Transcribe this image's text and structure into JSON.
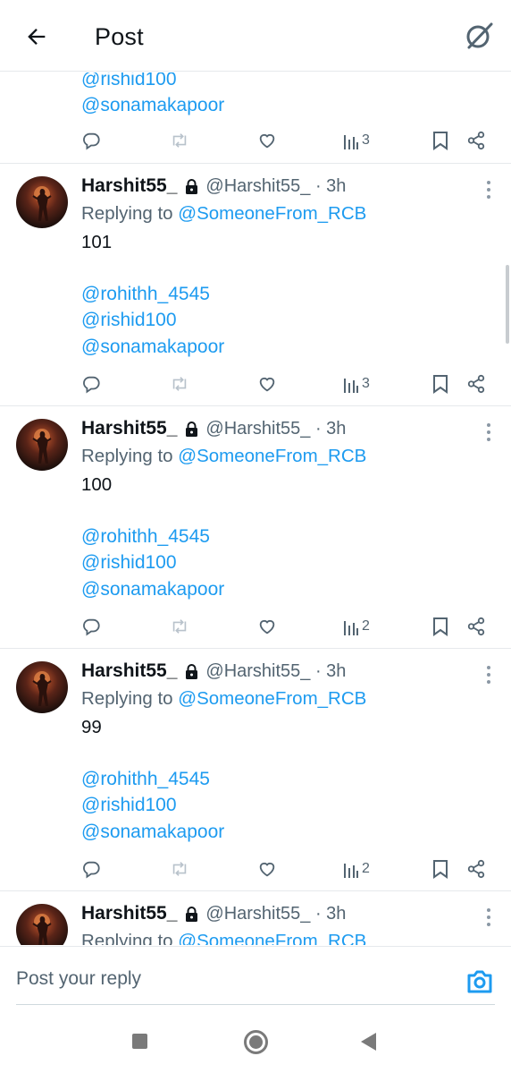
{
  "header": {
    "title": "Post",
    "back_icon": "arrow-left-icon",
    "right_icon": "grok-slash-circle-icon"
  },
  "top_partial": {
    "mentions": [
      "@rishid100",
      "@sonamakapoor"
    ],
    "views": "3"
  },
  "tweets": [
    {
      "name": "Harshit55_",
      "handle": "@Harshit55_ · 3h",
      "replying_prefix": "Replying to ",
      "replying_to": "@SomeoneFrom_RCB",
      "text": "101",
      "mentions": [
        "@rohithh_4545",
        "@rishid100",
        "@sonamakapoor"
      ],
      "views": "3"
    },
    {
      "name": "Harshit55_",
      "handle": "@Harshit55_ · 3h",
      "replying_prefix": "Replying to ",
      "replying_to": "@SomeoneFrom_RCB",
      "text": "100",
      "mentions": [
        "@rohithh_4545",
        "@rishid100",
        "@sonamakapoor"
      ],
      "views": "2"
    },
    {
      "name": "Harshit55_",
      "handle": "@Harshit55_ · 3h",
      "replying_prefix": "Replying to ",
      "replying_to": "@SomeoneFrom_RCB",
      "text": "99",
      "mentions": [
        "@rohithh_4545",
        "@rishid100",
        "@sonamakapoor"
      ],
      "views": "2"
    },
    {
      "name": "Harshit55_",
      "handle": "@Harshit55_ · 3h",
      "replying_prefix": "Replying to ",
      "replying_to": "@SomeoneFrom_RCB"
    }
  ],
  "reply_bar": {
    "placeholder": "Post your reply",
    "camera_icon": "camera-icon"
  },
  "colors": {
    "accent": "#1d9bf0",
    "secondary_text": "#536471",
    "divider": "#e6e9ec"
  }
}
